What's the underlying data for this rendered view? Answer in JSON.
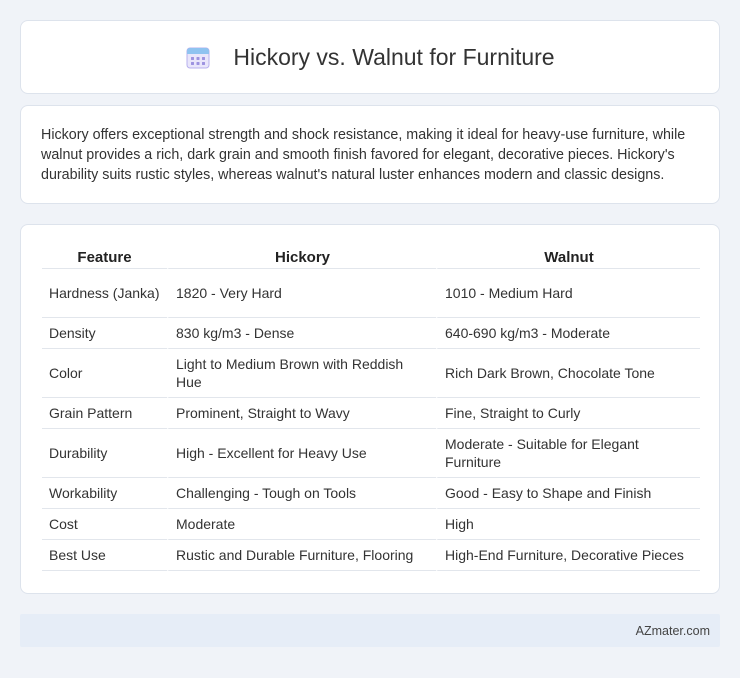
{
  "header": {
    "title": "Hickory vs. Walnut for Furniture",
    "icon": "calendar-icon",
    "accent_color": "#8a7fd8"
  },
  "intro": {
    "text": "Hickory offers exceptional strength and shock resistance, making it ideal for heavy-use furniture, while walnut provides a rich, dark grain and smooth finish favored for elegant, decorative pieces. Hickory's durability suits rustic styles, whereas walnut's natural luster enhances modern and classic designs."
  },
  "table": {
    "headers": [
      "Feature",
      "Hickory",
      "Walnut"
    ],
    "rows": [
      [
        "Hardness (Janka)",
        "1820 - Very Hard",
        "1010 - Medium Hard"
      ],
      [
        "Density",
        "830 kg/m3 - Dense",
        "640-690 kg/m3 - Moderate"
      ],
      [
        "Color",
        "Light to Medium Brown with Reddish Hue",
        "Rich Dark Brown, Chocolate Tone"
      ],
      [
        "Grain Pattern",
        "Prominent, Straight to Wavy",
        "Fine, Straight to Curly"
      ],
      [
        "Durability",
        "High - Excellent for Heavy Use",
        "Moderate - Suitable for Elegant Furniture"
      ],
      [
        "Workability",
        "Challenging - Tough on Tools",
        "Good - Easy to Shape and Finish"
      ],
      [
        "Cost",
        "Moderate",
        "High"
      ],
      [
        "Best Use",
        "Rustic and Durable Furniture, Flooring",
        "High-End Furniture, Decorative Pieces"
      ]
    ]
  },
  "footer": {
    "text": "AZmater.com"
  }
}
